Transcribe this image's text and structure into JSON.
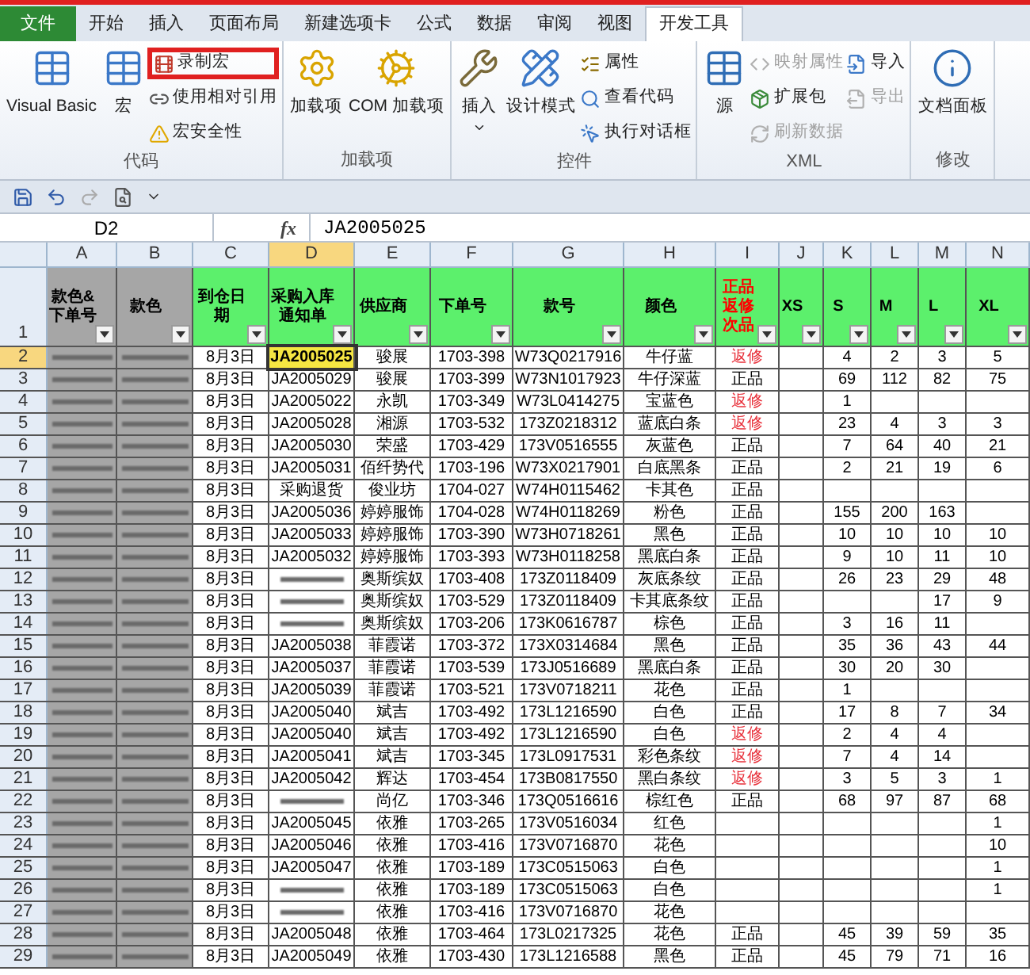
{
  "tabs": [
    {
      "label": "文件",
      "kind": "file",
      "selected": false
    },
    {
      "label": "开始",
      "kind": "tab",
      "selected": false
    },
    {
      "label": "插入",
      "kind": "tab",
      "selected": false
    },
    {
      "label": "页面布局",
      "kind": "tab",
      "selected": false
    },
    {
      "label": "新建选项卡",
      "kind": "tab",
      "selected": false
    },
    {
      "label": "公式",
      "kind": "tab",
      "selected": false
    },
    {
      "label": "数据",
      "kind": "tab",
      "selected": false
    },
    {
      "label": "审阅",
      "kind": "tab",
      "selected": false
    },
    {
      "label": "视图",
      "kind": "tab",
      "selected": false
    },
    {
      "label": "开发工具",
      "kind": "tab",
      "selected": true
    }
  ],
  "ribbon_groups": [
    {
      "label": "代码",
      "items": [
        {
          "label": "Visual Basic",
          "kind": "large",
          "disabled": false,
          "highlighted": false,
          "dropdown": false
        },
        {
          "label": "宏",
          "kind": "large",
          "disabled": false,
          "highlighted": false,
          "dropdown": false
        },
        {
          "label": "录制宏",
          "kind": "small",
          "disabled": false,
          "highlighted": true,
          "dropdown": false
        },
        {
          "label": "使用相对引用",
          "kind": "small",
          "disabled": false,
          "highlighted": false,
          "dropdown": false
        },
        {
          "label": "宏安全性",
          "kind": "small",
          "disabled": false,
          "highlighted": false,
          "dropdown": false
        }
      ]
    },
    {
      "label": "加载项",
      "items": [
        {
          "label": "加载项",
          "kind": "large",
          "disabled": false,
          "highlighted": false,
          "dropdown": false
        },
        {
          "label": "COM 加载项",
          "kind": "large",
          "disabled": false,
          "highlighted": false,
          "dropdown": false
        }
      ]
    },
    {
      "label": "控件",
      "items": [
        {
          "label": "插入",
          "kind": "large",
          "disabled": false,
          "highlighted": false,
          "dropdown": true
        },
        {
          "label": "设计模式",
          "kind": "large",
          "disabled": false,
          "highlighted": false,
          "dropdown": false
        },
        {
          "label": "属性",
          "kind": "small",
          "disabled": false,
          "highlighted": false,
          "dropdown": false
        },
        {
          "label": "查看代码",
          "kind": "small",
          "disabled": false,
          "highlighted": false,
          "dropdown": false
        },
        {
          "label": "执行对话框",
          "kind": "small",
          "disabled": false,
          "highlighted": false,
          "dropdown": false
        }
      ]
    },
    {
      "label": "XML",
      "items": [
        {
          "label": "源",
          "kind": "large",
          "disabled": false,
          "highlighted": false,
          "dropdown": false
        },
        {
          "label": "映射属性",
          "kind": "small",
          "disabled": true,
          "highlighted": false,
          "dropdown": false
        },
        {
          "label": "扩展包",
          "kind": "small",
          "disabled": false,
          "highlighted": false,
          "dropdown": false
        },
        {
          "label": "刷新数据",
          "kind": "small",
          "disabled": true,
          "highlighted": false,
          "dropdown": false
        },
        {
          "label": "导入",
          "kind": "small",
          "disabled": false,
          "highlighted": false,
          "dropdown": false
        },
        {
          "label": "导出",
          "kind": "small",
          "disabled": true,
          "highlighted": false,
          "dropdown": false
        }
      ]
    },
    {
      "label": "修改",
      "items": [
        {
          "label": "文档面板",
          "kind": "large",
          "disabled": false,
          "highlighted": false,
          "dropdown": false
        }
      ]
    }
  ],
  "name_box": "D2",
  "formula_label": "fx",
  "formula": "JA2005025",
  "columns": [
    {
      "letter": "A",
      "title": "款色&下单号",
      "color": "#a6a6a6",
      "kind": "plain",
      "selected": false
    },
    {
      "letter": "B",
      "title": "款色",
      "color": "#a6a6a6",
      "kind": "plain",
      "selected": false
    },
    {
      "letter": "C",
      "title": "到仓日期",
      "color": "#5cf06c",
      "kind": "plain",
      "selected": false
    },
    {
      "letter": "D",
      "title": "采购入库通知单",
      "color": "#5cf06c",
      "kind": "plain",
      "selected": true
    },
    {
      "letter": "E",
      "title": "供应商",
      "color": "#5cf06c",
      "kind": "plain",
      "selected": false
    },
    {
      "letter": "F",
      "title": "下单号",
      "color": "#5cf06c",
      "kind": "plain",
      "selected": false
    },
    {
      "letter": "G",
      "title": "款号",
      "color": "#5cf06c",
      "kind": "plain",
      "selected": false
    },
    {
      "letter": "H",
      "title": "颜色",
      "color": "#5cf06c",
      "kind": "plain",
      "selected": false
    },
    {
      "letter": "I",
      "title": "正品返修次品",
      "color": "#5cf06c",
      "kind": "status",
      "selected": false
    },
    {
      "letter": "J",
      "title": "XS",
      "color": "#5cf06c",
      "kind": "plain",
      "selected": false
    },
    {
      "letter": "K",
      "title": "S",
      "color": "#5cf06c",
      "kind": "plain",
      "selected": false
    },
    {
      "letter": "L",
      "title": "M",
      "color": "#5cf06c",
      "kind": "plain",
      "selected": false
    },
    {
      "letter": "M",
      "title": "L",
      "color": "#5cf06c",
      "kind": "plain",
      "selected": false
    },
    {
      "letter": "N",
      "title": "XL",
      "color": "#5cf06c",
      "kind": "plain",
      "selected": false
    }
  ],
  "header_row": "1",
  "rows": [
    {
      "row": "2",
      "selected": true,
      "kind": "repair",
      "cells": [
        "8月3日",
        "JA2005025",
        "骏展",
        "1703-398",
        "W73Q0217916",
        "牛仔蓝",
        "返修",
        null,
        "4",
        "2",
        "3",
        "5"
      ]
    },
    {
      "row": "3",
      "selected": false,
      "kind": "normal",
      "cells": [
        "8月3日",
        "JA2005029",
        "骏展",
        "1703-399",
        "W73N1017923",
        "牛仔深蓝",
        "正品",
        null,
        "69",
        "112",
        "82",
        "75"
      ]
    },
    {
      "row": "4",
      "selected": false,
      "kind": "repair",
      "cells": [
        "8月3日",
        "JA2005022",
        "永凯",
        "1703-349",
        "W73L0414275",
        "宝蓝色",
        "返修",
        null,
        "1",
        null,
        null,
        null
      ]
    },
    {
      "row": "5",
      "selected": false,
      "kind": "repair",
      "cells": [
        "8月3日",
        "JA2005028",
        "湘源",
        "1703-532",
        "173Z0218312",
        "蓝底白条",
        "返修",
        null,
        "23",
        "4",
        "3",
        "3"
      ]
    },
    {
      "row": "6",
      "selected": false,
      "kind": "normal",
      "cells": [
        "8月3日",
        "JA2005030",
        "荣盛",
        "1703-429",
        "173V0516555",
        "灰蓝色",
        "正品",
        null,
        "7",
        "64",
        "40",
        "21"
      ]
    },
    {
      "row": "7",
      "selected": false,
      "kind": "normal",
      "cells": [
        "8月3日",
        "JA2005031",
        "佰纤势代",
        "1703-196",
        "W73X0217901",
        "白底黑条",
        "正品",
        null,
        "2",
        "21",
        "19",
        "6"
      ]
    },
    {
      "row": "8",
      "selected": false,
      "kind": "normal",
      "cells": [
        "8月3日",
        "采购退货",
        "俊业坊",
        "1704-027",
        "W74H0115462",
        "卡其色",
        "正品",
        null,
        null,
        null,
        null,
        null
      ]
    },
    {
      "row": "9",
      "selected": false,
      "kind": "normal",
      "cells": [
        "8月3日",
        "JA2005036",
        "婷婷服饰",
        "1704-028",
        "W74H0118269",
        "粉色",
        "正品",
        null,
        "155",
        "200",
        "163",
        null
      ]
    },
    {
      "row": "10",
      "selected": false,
      "kind": "normal",
      "cells": [
        "8月3日",
        "JA2005033",
        "婷婷服饰",
        "1703-390",
        "W73H0718261",
        "黑色",
        "正品",
        null,
        "10",
        "10",
        "10",
        "10"
      ]
    },
    {
      "row": "11",
      "selected": false,
      "kind": "normal",
      "cells": [
        "8月3日",
        "JA2005032",
        "婷婷服饰",
        "1703-393",
        "W73H0118258",
        "黑底白条",
        "正品",
        null,
        "9",
        "10",
        "11",
        "10"
      ]
    },
    {
      "row": "12",
      "selected": false,
      "kind": "normal",
      "cells": [
        "8月3日",
        {
          "kind": "blurred"
        },
        "奥斯缤奴",
        "1703-408",
        "173Z0118409",
        "灰底条纹",
        "正品",
        null,
        "26",
        "23",
        "29",
        "48"
      ]
    },
    {
      "row": "13",
      "selected": false,
      "kind": "normal",
      "cells": [
        "8月3日",
        {
          "kind": "blurred"
        },
        "奥斯缤奴",
        "1703-529",
        "173Z0118409",
        "卡其底条纹",
        "正品",
        null,
        null,
        null,
        "17",
        "9"
      ]
    },
    {
      "row": "14",
      "selected": false,
      "kind": "normal",
      "cells": [
        "8月3日",
        {
          "kind": "blurred"
        },
        "奥斯缤奴",
        "1703-206",
        "173K0616787",
        "棕色",
        "正品",
        null,
        "3",
        "16",
        "11",
        null
      ]
    },
    {
      "row": "15",
      "selected": false,
      "kind": "normal",
      "cells": [
        "8月3日",
        "JA2005038",
        "菲霞诺",
        "1703-372",
        "173X0314684",
        "黑色",
        "正品",
        null,
        "35",
        "36",
        "43",
        "44"
      ]
    },
    {
      "row": "16",
      "selected": false,
      "kind": "normal",
      "cells": [
        "8月3日",
        "JA2005037",
        "菲霞诺",
        "1703-539",
        "173J0516689",
        "黑底白条",
        "正品",
        null,
        "30",
        "20",
        "30",
        null
      ]
    },
    {
      "row": "17",
      "selected": false,
      "kind": "normal",
      "cells": [
        "8月3日",
        "JA2005039",
        "菲霞诺",
        "1703-521",
        "173V0718211",
        "花色",
        "正品",
        null,
        "1",
        null,
        null,
        null
      ]
    },
    {
      "row": "18",
      "selected": false,
      "kind": "normal",
      "cells": [
        "8月3日",
        "JA2005040",
        "斌吉",
        "1703-492",
        "173L1216590",
        "白色",
        "正品",
        null,
        "17",
        "8",
        "7",
        "34"
      ]
    },
    {
      "row": "19",
      "selected": false,
      "kind": "repair",
      "cells": [
        "8月3日",
        "JA2005040",
        "斌吉",
        "1703-492",
        "173L1216590",
        "白色",
        "返修",
        null,
        "2",
        "4",
        "4",
        null
      ]
    },
    {
      "row": "20",
      "selected": false,
      "kind": "repair",
      "cells": [
        "8月3日",
        "JA2005041",
        "斌吉",
        "1703-345",
        "173L0917531",
        "彩色条纹",
        "返修",
        null,
        "7",
        "4",
        "14",
        null
      ]
    },
    {
      "row": "21",
      "selected": false,
      "kind": "repair",
      "cells": [
        "8月3日",
        "JA2005042",
        "辉达",
        "1703-454",
        "173B0817550",
        "黑白条纹",
        "返修",
        null,
        "3",
        "5",
        "3",
        "1"
      ]
    },
    {
      "row": "22",
      "selected": false,
      "kind": "normal",
      "cells": [
        "8月3日",
        {
          "kind": "blurred"
        },
        "尚亿",
        "1703-346",
        "173Q0516616",
        "棕红色",
        "正品",
        null,
        "68",
        "97",
        "87",
        "68"
      ]
    },
    {
      "row": "23",
      "selected": false,
      "cells": [
        "8月3日",
        "JA2005045",
        "依雅",
        "1703-265",
        "173V0516034",
        "红色",
        null,
        null,
        null,
        null,
        null,
        "1"
      ]
    },
    {
      "row": "24",
      "selected": false,
      "cells": [
        "8月3日",
        "JA2005046",
        "依雅",
        "1703-416",
        "173V0716870",
        "花色",
        null,
        null,
        null,
        null,
        null,
        "10"
      ]
    },
    {
      "row": "25",
      "selected": false,
      "cells": [
        "8月3日",
        "JA2005047",
        "依雅",
        "1703-189",
        "173C0515063",
        "白色",
        null,
        null,
        null,
        null,
        null,
        "1"
      ]
    },
    {
      "row": "26",
      "selected": false,
      "cells": [
        "8月3日",
        {
          "kind": "blurred"
        },
        "依雅",
        "1703-189",
        "173C0515063",
        "白色",
        null,
        null,
        null,
        null,
        null,
        "1"
      ]
    },
    {
      "row": "27",
      "selected": false,
      "cells": [
        "8月3日",
        {
          "kind": "blurred"
        },
        "依雅",
        "1703-416",
        "173V0716870",
        "花色",
        null,
        null,
        null,
        null,
        null,
        null
      ]
    },
    {
      "row": "28",
      "selected": false,
      "kind": "normal",
      "cells": [
        "8月3日",
        "JA2005048",
        "依雅",
        "1703-464",
        "173L0217325",
        "花色",
        "正品",
        null,
        "45",
        "39",
        "59",
        "35"
      ]
    },
    {
      "row": "29",
      "selected": false,
      "kind": "normal",
      "cells": [
        "8月3日",
        "JA2005049",
        "依雅",
        "1703-430",
        "173L1216588",
        "黑色",
        "正品",
        null,
        "45",
        "79",
        "71",
        "16"
      ]
    }
  ]
}
